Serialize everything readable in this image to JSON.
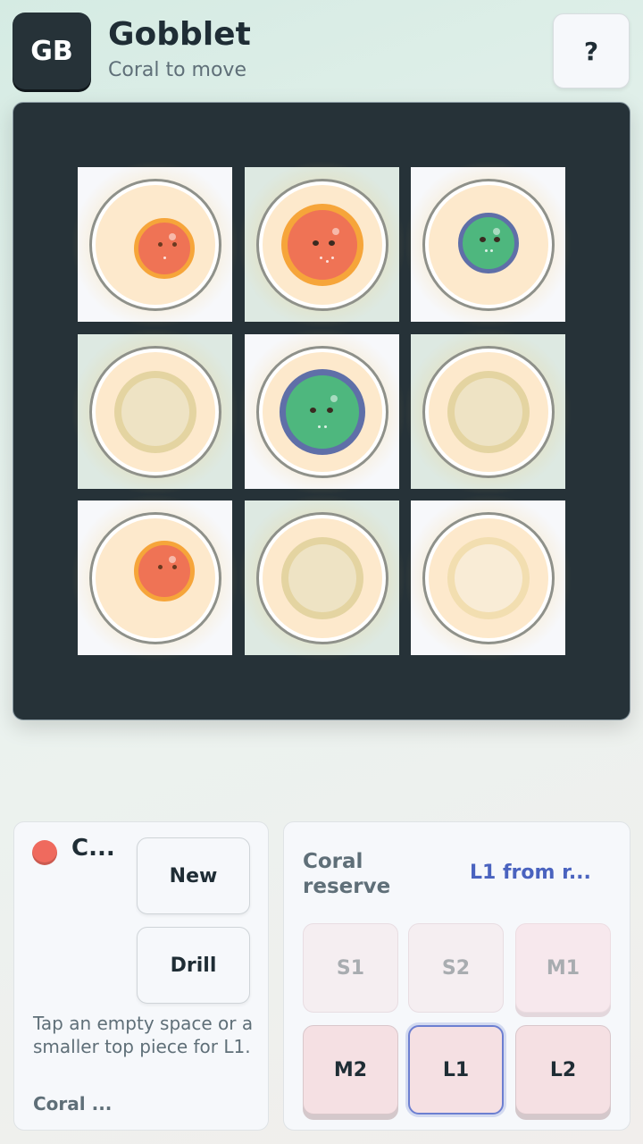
{
  "header": {
    "logo": "GB",
    "title": "Gobblet",
    "subtitle": "Coral to move",
    "help_label": "?"
  },
  "board": {
    "cells": [
      {
        "id": "a1",
        "top": {
          "color": "coral",
          "size": "S"
        }
      },
      {
        "id": "b1",
        "top": {
          "color": "coral",
          "size": "M"
        }
      },
      {
        "id": "c1",
        "top": {
          "color": "green",
          "size": "S"
        }
      },
      {
        "id": "a2",
        "top": null
      },
      {
        "id": "b2",
        "top": {
          "color": "green",
          "size": "L"
        }
      },
      {
        "id": "c2",
        "top": null
      },
      {
        "id": "a3",
        "top": {
          "color": "coral",
          "size": "S"
        }
      },
      {
        "id": "b3",
        "top": null
      },
      {
        "id": "c3",
        "top": null
      }
    ]
  },
  "status": {
    "turn_name": "C...",
    "new_label": "New",
    "drill_label": "Drill",
    "hint": "Tap an empty space or a smaller top piece for L1.",
    "footer": "Coral ..."
  },
  "reserve": {
    "title": "Coral reserve",
    "selected_text": "L1 from r...",
    "pieces": [
      {
        "label": "S1",
        "state": "used"
      },
      {
        "label": "S2",
        "state": "used"
      },
      {
        "label": "M1",
        "state": "used"
      },
      {
        "label": "M2",
        "state": "available"
      },
      {
        "label": "L1",
        "state": "selected"
      },
      {
        "label": "L2",
        "state": "available"
      }
    ]
  },
  "colors": {
    "coral": "#ef7355",
    "green": "#4eb77e",
    "board": "#263238",
    "accent": "#4a63bf"
  }
}
